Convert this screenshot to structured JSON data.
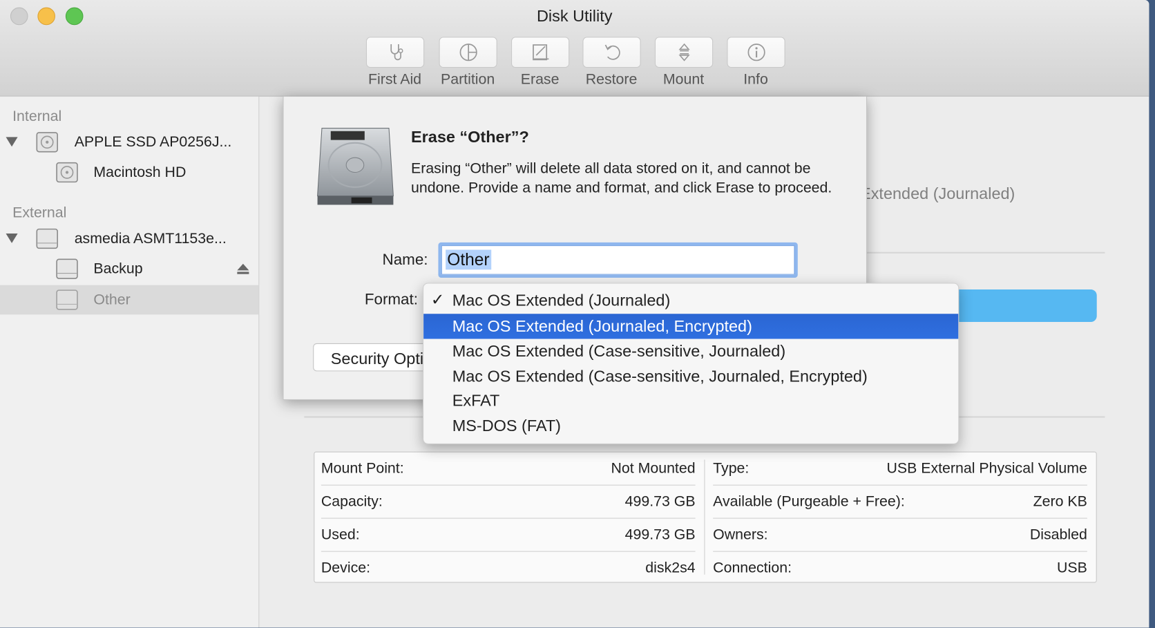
{
  "window": {
    "title": "Disk Utility"
  },
  "toolbar": [
    {
      "label": "First Aid",
      "icon": "stethoscope-icon"
    },
    {
      "label": "Partition",
      "icon": "pie-icon"
    },
    {
      "label": "Erase",
      "icon": "erase-icon"
    },
    {
      "label": "Restore",
      "icon": "restore-icon"
    },
    {
      "label": "Mount",
      "icon": "mount-icon"
    },
    {
      "label": "Info",
      "icon": "info-icon"
    }
  ],
  "sidebar": {
    "internal_label": "Internal",
    "external_label": "External",
    "items": [
      {
        "label": "APPLE SSD AP0256J..."
      },
      {
        "label": "Macintosh HD"
      },
      {
        "label": "asmedia ASMT1153e..."
      },
      {
        "label": "Backup"
      },
      {
        "label": "Other",
        "selected": true
      }
    ]
  },
  "background": {
    "format_text": "Mac OS Extended (Journaled)",
    "usage_color": "#56b8f2"
  },
  "info": {
    "left": [
      {
        "k": "Mount Point:",
        "v": "Not Mounted"
      },
      {
        "k": "Capacity:",
        "v": "499.73 GB"
      },
      {
        "k": "Used:",
        "v": "499.73 GB"
      },
      {
        "k": "Device:",
        "v": "disk2s4"
      }
    ],
    "right": [
      {
        "k": "Type:",
        "v": "USB External Physical Volume"
      },
      {
        "k": "Available (Purgeable + Free):",
        "v": "Zero KB"
      },
      {
        "k": "Owners:",
        "v": "Disabled"
      },
      {
        "k": "Connection:",
        "v": "USB"
      }
    ]
  },
  "sheet": {
    "title": "Erase “Other”?",
    "body": "Erasing “Other” will delete all data stored on it, and cannot be undone. Provide a name and format, and click Erase to proceed.",
    "name_label": "Name:",
    "name_value": "Other",
    "format_label": "Format:",
    "security_button": "Security Options..."
  },
  "format_menu": {
    "checked_index": 0,
    "highlighted_index": 1,
    "highlight_color": "#2a6ad8",
    "items": [
      "Mac OS Extended (Journaled)",
      "Mac OS Extended (Journaled, Encrypted)",
      "Mac OS Extended (Case-sensitive, Journaled)",
      "Mac OS Extended (Case-sensitive, Journaled, Encrypted)",
      "ExFAT",
      "MS-DOS (FAT)"
    ]
  }
}
